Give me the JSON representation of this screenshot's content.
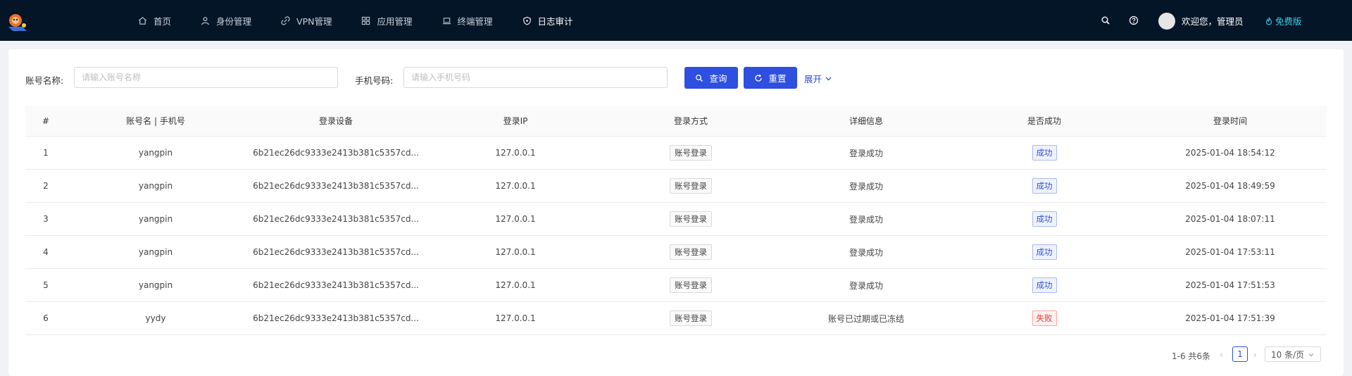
{
  "nav": {
    "items": [
      {
        "label": "首页",
        "icon": "home-icon"
      },
      {
        "label": "身份管理",
        "icon": "user-icon"
      },
      {
        "label": "VPN管理",
        "icon": "link-icon"
      },
      {
        "label": "应用管理",
        "icon": "apps-icon"
      },
      {
        "label": "终端管理",
        "icon": "laptop-icon"
      },
      {
        "label": "日志审计",
        "icon": "shield-icon",
        "active": true
      }
    ],
    "welcome": "欢迎您，管理员",
    "edition": "免费版",
    "colors": {
      "topbar": "#041528",
      "accent": "#2e4fe0",
      "edition": "#36d2e6"
    }
  },
  "filters": {
    "account_label": "账号名称:",
    "account_placeholder": "请输入账号名称",
    "phone_label": "手机号码:",
    "phone_placeholder": "请输入手机号码",
    "search_label": "查询",
    "reset_label": "重置",
    "expand_label": "展开"
  },
  "table": {
    "columns": [
      "#",
      "账号名 | 手机号",
      "登录设备",
      "登录IP",
      "登录方式",
      "详细信息",
      "是否成功",
      "登录时间"
    ],
    "rows": [
      {
        "idx": "1",
        "account": "yangpin",
        "device": "6b21ec26dc9333e2413b381c5357cd...",
        "ip": "127.0.0.1",
        "method": "账号登录",
        "detail": "登录成功",
        "status": "成功",
        "ok": true,
        "time": "2025-01-04 18:54:12"
      },
      {
        "idx": "2",
        "account": "yangpin",
        "device": "6b21ec26dc9333e2413b381c5357cd...",
        "ip": "127.0.0.1",
        "method": "账号登录",
        "detail": "登录成功",
        "status": "成功",
        "ok": true,
        "time": "2025-01-04 18:49:59"
      },
      {
        "idx": "3",
        "account": "yangpin",
        "device": "6b21ec26dc9333e2413b381c5357cd...",
        "ip": "127.0.0.1",
        "method": "账号登录",
        "detail": "登录成功",
        "status": "成功",
        "ok": true,
        "time": "2025-01-04 18:07:11"
      },
      {
        "idx": "4",
        "account": "yangpin",
        "device": "6b21ec26dc9333e2413b381c5357cd...",
        "ip": "127.0.0.1",
        "method": "账号登录",
        "detail": "登录成功",
        "status": "成功",
        "ok": true,
        "time": "2025-01-04 17:53:11"
      },
      {
        "idx": "5",
        "account": "yangpin",
        "device": "6b21ec26dc9333e2413b381c5357cd...",
        "ip": "127.0.0.1",
        "method": "账号登录",
        "detail": "登录成功",
        "status": "成功",
        "ok": true,
        "time": "2025-01-04 17:51:53"
      },
      {
        "idx": "6",
        "account": "yydy",
        "device": "6b21ec26dc9333e2413b381c5357cd...",
        "ip": "127.0.0.1",
        "method": "账号登录",
        "detail": "账号已过期或已冻结",
        "status": "失败",
        "ok": false,
        "time": "2025-01-04 17:51:39"
      }
    ]
  },
  "pagination": {
    "total": "1-6 共6条",
    "current_page": "1",
    "page_size": "10 条/页"
  }
}
